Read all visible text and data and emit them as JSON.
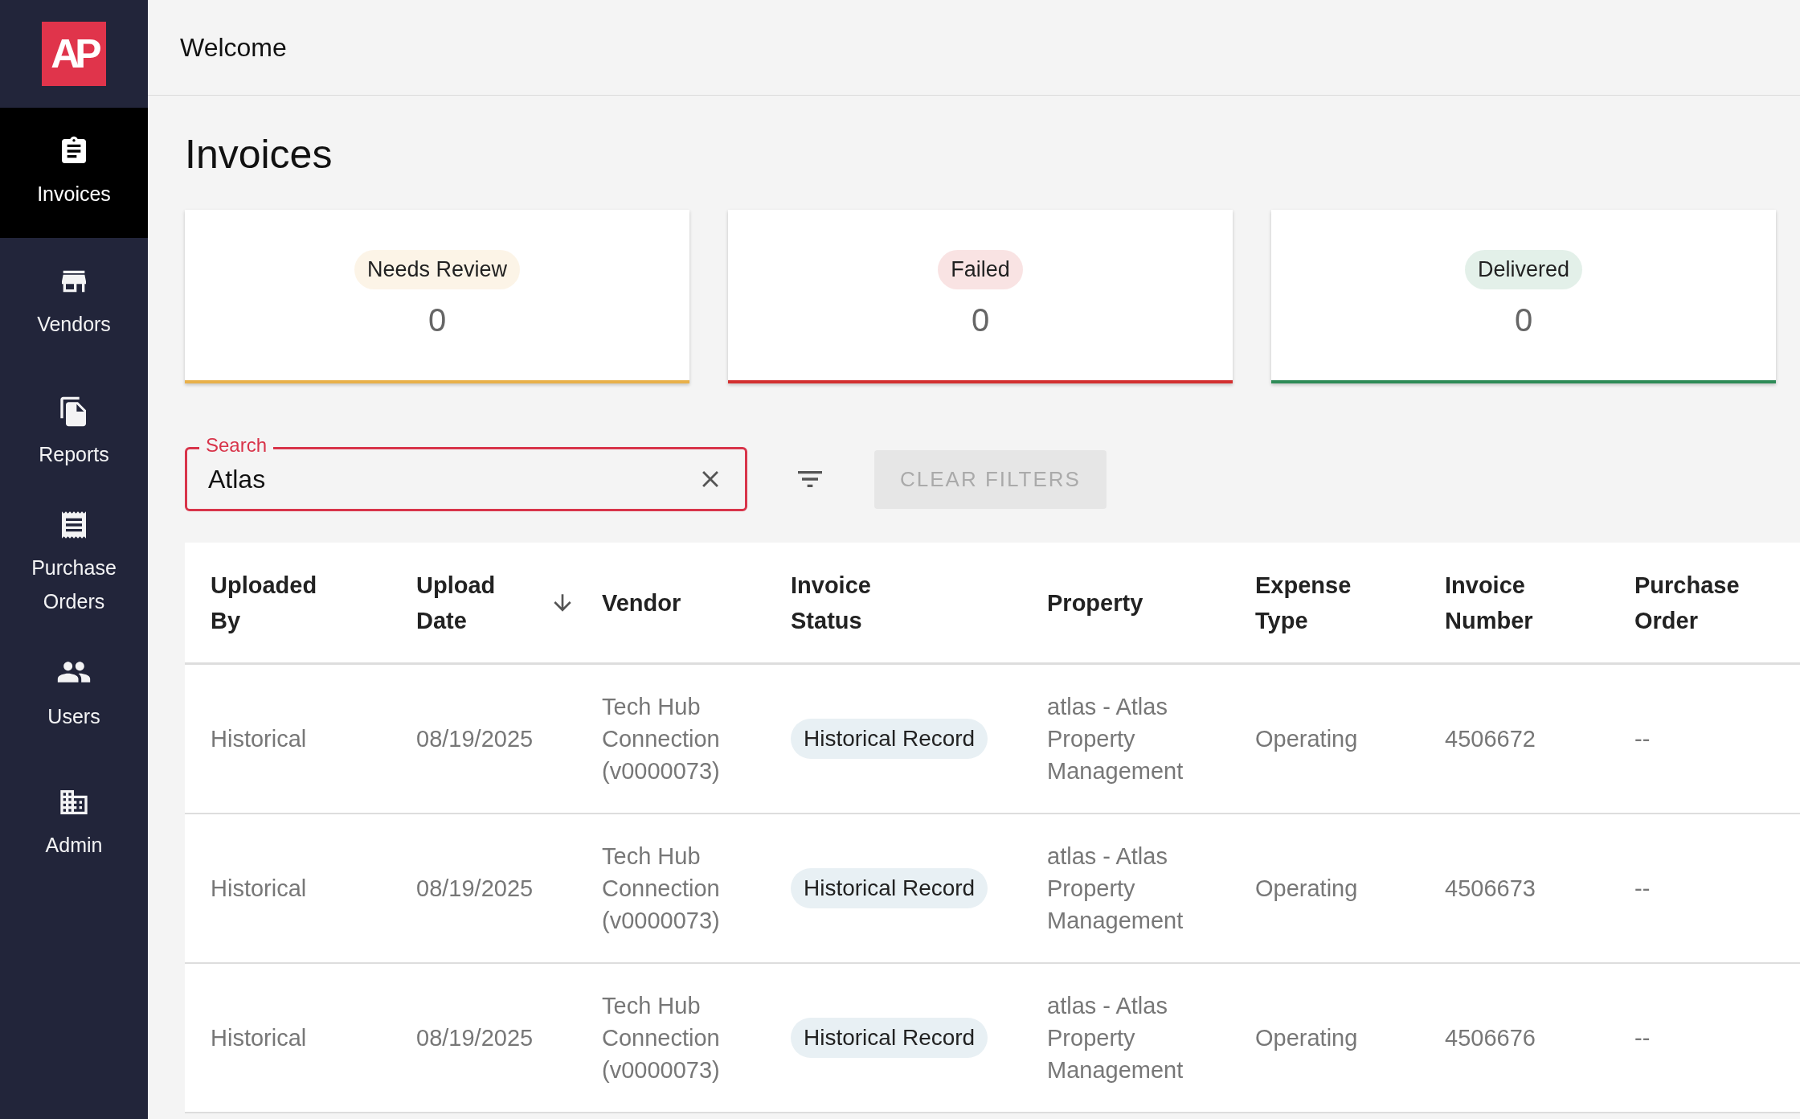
{
  "logo": {
    "text": "AP"
  },
  "sidebar": {
    "items": [
      {
        "label": "Invoices",
        "kind": "invoices",
        "selected": true
      },
      {
        "label": "Vendors",
        "kind": "vendors",
        "selected": false
      },
      {
        "label": "Reports",
        "kind": "reports",
        "selected": false
      },
      {
        "label": "Purchase Orders",
        "kind": "orders",
        "selected": false
      },
      {
        "label": "Users",
        "kind": "users",
        "selected": false
      },
      {
        "label": "Admin",
        "kind": "admin",
        "selected": false
      }
    ]
  },
  "header": {
    "title": "Welcome"
  },
  "page_title": "Invoices",
  "status_cards": [
    {
      "label": "Needs Review",
      "count": "0",
      "color": "#e8b04a"
    },
    {
      "label": "Failed",
      "count": "0",
      "color": "#d32f2f"
    },
    {
      "label": "Delivered",
      "count": "0",
      "color": "#2e8b57"
    }
  ],
  "search": {
    "label": "Search",
    "value": "Atlas"
  },
  "clear_filters": {
    "label": "CLEAR FILTERS",
    "disabled": true
  },
  "table": {
    "columns": [
      {
        "label": "Uploaded By",
        "sorted": false
      },
      {
        "label": "Upload Date",
        "sorted": true
      },
      {
        "label": "Vendor",
        "sorted": false
      },
      {
        "label": "Invoice Status",
        "sorted": false
      },
      {
        "label": "Property",
        "sorted": false
      },
      {
        "label": "Expense Type",
        "sorted": false
      },
      {
        "label": "Invoice Number",
        "sorted": false
      },
      {
        "label": "Purchase Order",
        "sorted": false
      }
    ],
    "rows": [
      {
        "cells": [
          "Historical",
          "08/19/2025",
          "Tech Hub Connection (v0000073)",
          "Historical Record",
          "atlas - Atlas Property Management",
          "Operating",
          "4506672",
          "--"
        ]
      },
      {
        "cells": [
          "Historical",
          "08/19/2025",
          "Tech Hub Connection (v0000073)",
          "Historical Record",
          "atlas - Atlas Property Management",
          "Operating",
          "4506673",
          "--"
        ]
      },
      {
        "cells": [
          "Historical",
          "08/19/2025",
          "Tech Hub Connection (v0000073)",
          "Historical Record",
          "atlas - Atlas Property Management",
          "Operating",
          "4506676",
          "--"
        ]
      }
    ]
  }
}
